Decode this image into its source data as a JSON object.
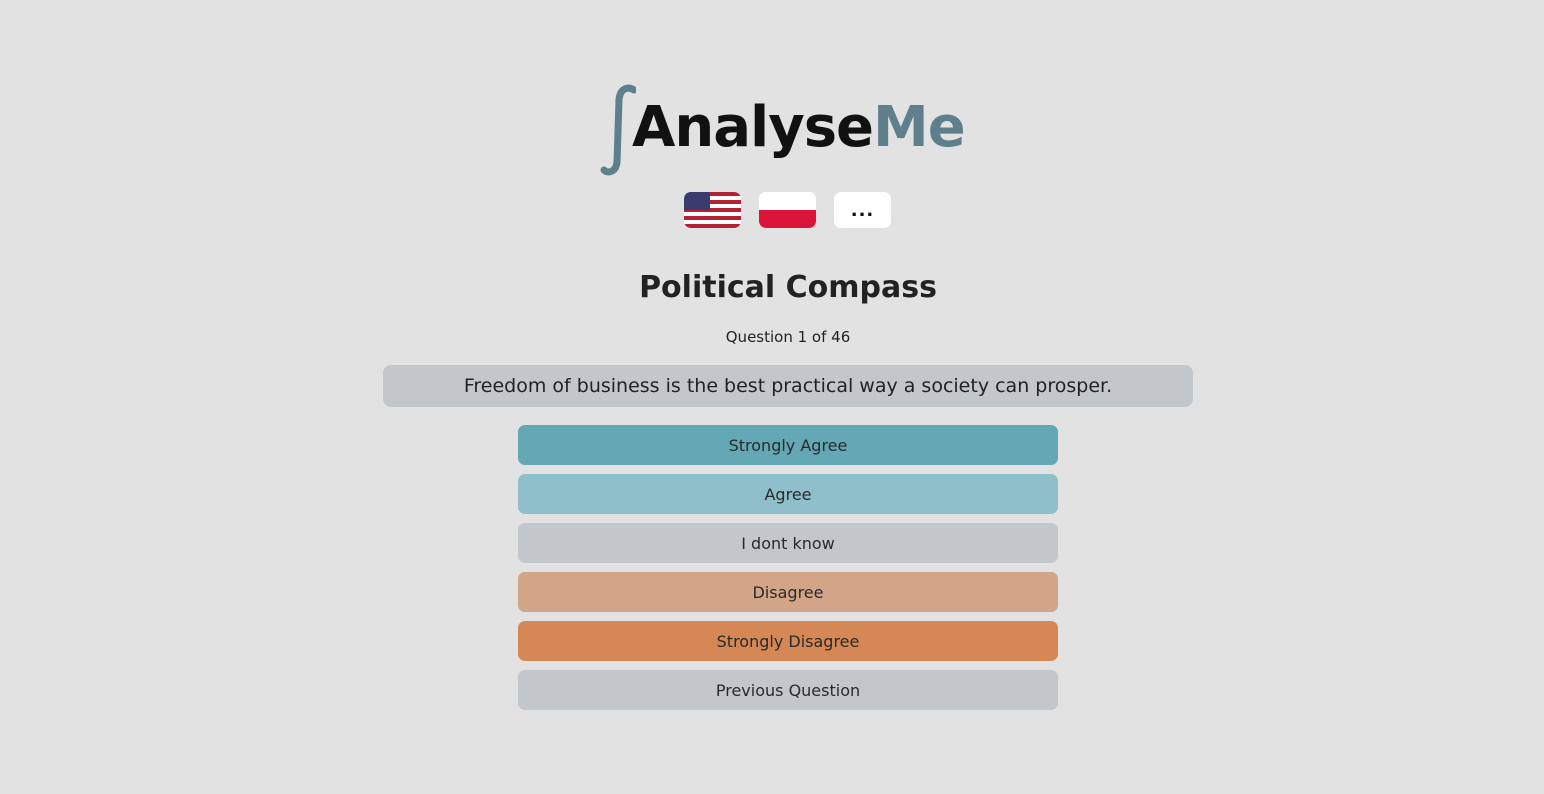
{
  "brand": {
    "name_part1": "Analyse",
    "name_part2": "Me",
    "integral_glyph": "∫",
    "colors": {
      "dark": "#111111",
      "accent": "#5f7f8c"
    }
  },
  "languages": {
    "items": [
      {
        "name": "us-flag-icon"
      },
      {
        "name": "pl-flag-icon"
      }
    ],
    "more_label": "..."
  },
  "quiz": {
    "title": "Political Compass",
    "counter": "Question 1 of 46",
    "question": "Freedom of business is the best practical way a society can prosper."
  },
  "answers": [
    {
      "label": "Strongly Agree",
      "color": "#64a8b6"
    },
    {
      "label": "Agree",
      "color": "#8ebfca"
    },
    {
      "label": "I dont know",
      "color": "#c1c7ca"
    },
    {
      "label": "Disagree",
      "color": "#d2a588"
    },
    {
      "label": "Strongly Disagree",
      "color": "#d58755"
    },
    {
      "label": "Previous Question",
      "color": "#c1c7ca"
    }
  ]
}
